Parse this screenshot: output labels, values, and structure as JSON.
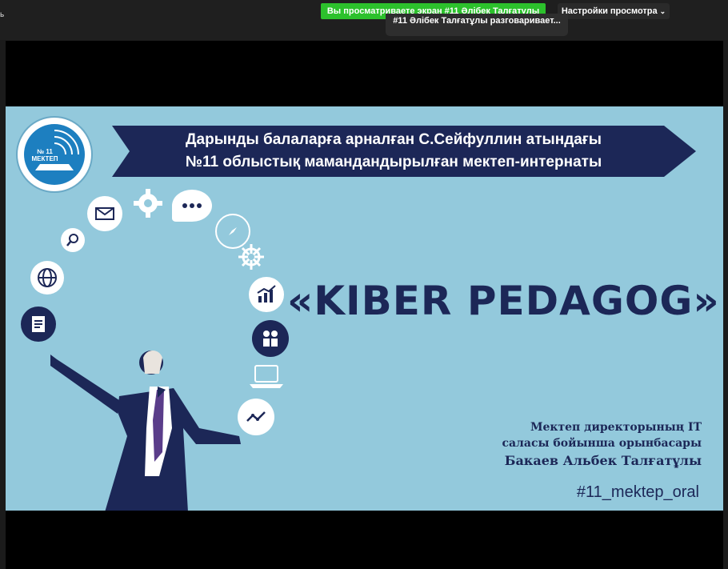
{
  "meeting": {
    "corner_glyph": "ь",
    "share_banner": "Вы просматриваете экран #11 Әлібек Талғатұлы",
    "view_settings": "Настройки просмотра",
    "speaker_label": "#11 Әлібек Талғатұлы разговаривает..."
  },
  "slide": {
    "ribbon_line1": "Дарынды балаларға арналған С.Сейфуллин атындағы",
    "ribbon_line2": "№11 облыстық мамандандырылған мектеп-интернаты",
    "logo_text": "№ 11 МЕКТЕП",
    "title": "«KIBER PEDAGOG»",
    "subtitle_line1": "Мектеп директорының IT",
    "subtitle_line2": "саласы бойынша орынбасары",
    "presenter_name": "Бакаев Альбек Талғатұлы",
    "hashtag": "#11_mektep_oral"
  },
  "colors": {
    "slide_bg": "#93c9dc",
    "navy": "#1c2757",
    "banner_green": "#2cc12c"
  },
  "icons": [
    "document-icon",
    "globe-icon",
    "search-icon",
    "mail-icon",
    "gear-icon",
    "chat-icon",
    "compass-icon",
    "helm-icon",
    "chart-icon",
    "team-icon",
    "laptop-icon",
    "trend-icon"
  ]
}
